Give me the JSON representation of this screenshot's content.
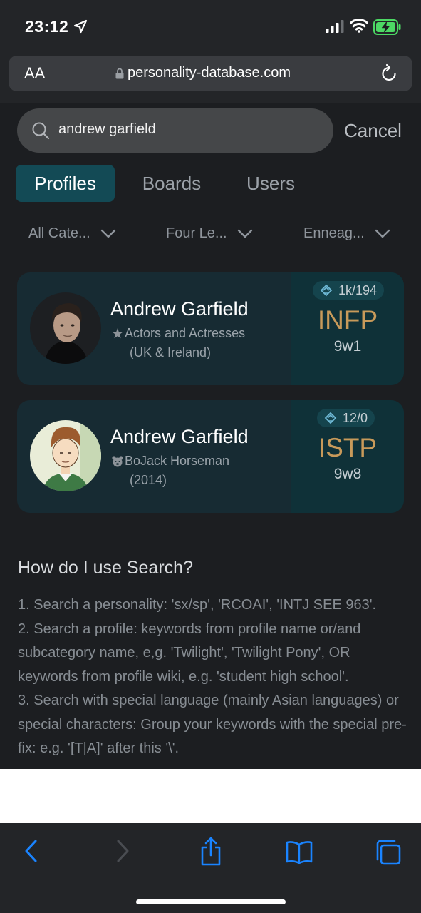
{
  "status_bar": {
    "time": "23:12"
  },
  "address_bar": {
    "text_size_label": "AA",
    "url": "personality-database.com"
  },
  "search": {
    "query": "andrew garfield",
    "cancel_label": "Cancel"
  },
  "tabs": [
    {
      "label": "Profiles",
      "active": true
    },
    {
      "label": "Boards",
      "active": false
    },
    {
      "label": "Users",
      "active": false
    }
  ],
  "filters": [
    {
      "label": "All Cate..."
    },
    {
      "label": "Four Le..."
    },
    {
      "label": "Enneag..."
    }
  ],
  "results": [
    {
      "name": "Andrew Garfield",
      "category_line1": "Actors and Actresses",
      "category_line2": "(UK & Ireland)",
      "category_icon": "actor-star-icon",
      "votes": "1k/194",
      "type": "INFP",
      "enneagram": "9w1"
    },
    {
      "name": "Andrew Garfield",
      "category_line1": "BoJack Horseman",
      "category_line2": "(2014)",
      "category_icon": "bear-icon",
      "votes": "12/0",
      "type": "ISTP",
      "enneagram": "9w8"
    }
  ],
  "help": {
    "title": "How do I use Search?",
    "lines": [
      "1. Search a personality: 'sx/sp', 'RCOAI', 'INTJ SEE 963'.",
      "2. Search a profile: keywords from profile name or/and subcategory name, e,g. 'Twilight', 'Twilight Pony', OR keywords from profile wiki, e.g. 'student high school'.",
      "3. Search with special language (mainly Asian languages) or special characters: Group your keywords with the special pre-fix: e.g. '[T|A]' after this '\\'."
    ]
  },
  "colors": {
    "accent_tab": "#134a55",
    "type_gold": "#c89a5a",
    "card_bg": "#172b33",
    "ios_blue": "#1a84ff"
  },
  "toolbar_icons": [
    "back-icon",
    "forward-icon",
    "share-icon",
    "bookmarks-icon",
    "tabs-icon"
  ]
}
